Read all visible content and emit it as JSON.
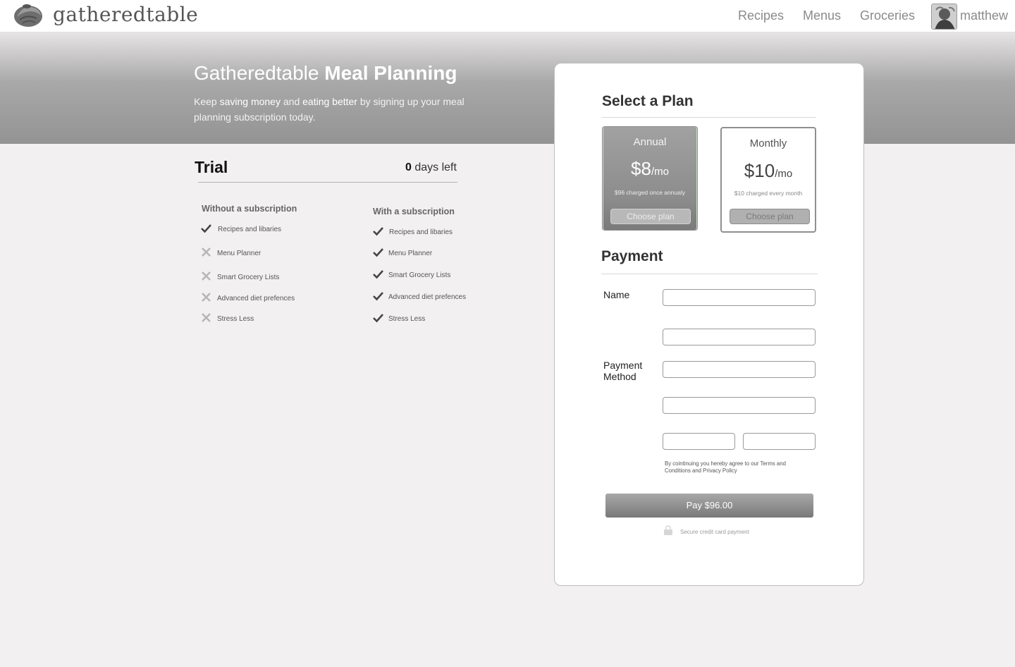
{
  "header": {
    "logo_text": "gatheredtable",
    "nav": {
      "recipes": "Recipes",
      "menus": "Menus",
      "groceries": "Groceries"
    },
    "username": "matthew"
  },
  "hero": {
    "title_light": "Gatheredtable ",
    "title_bold": "Meal Planning",
    "sub_1": "Keep ",
    "sub_em1": "saving money",
    "sub_2": " and ",
    "sub_em2": "eating better",
    "sub_3": " by signing up your meal planning subscription today."
  },
  "trial": {
    "title": "Trial",
    "days_count": "0",
    "days_suffix": " days left",
    "without_head": "Without a subscription",
    "with_head": "With a subscription",
    "features": [
      {
        "label": "Recipes and libaries",
        "without": "check",
        "with": "check"
      },
      {
        "label": "Menu Planner",
        "without": "x",
        "with": "check"
      },
      {
        "label": "Smart Grocery Lists",
        "without": "x",
        "with": "check"
      },
      {
        "label": "Advanced diet prefences",
        "without": "x",
        "with": "check"
      },
      {
        "label": "Stress Less",
        "without": "x",
        "with": "check"
      }
    ]
  },
  "plans": {
    "heading": "Select a Plan",
    "annual": {
      "name": "Annual",
      "price": "$8",
      "per": "/mo",
      "note": "$96 charged once annualy",
      "button": "Choose plan"
    },
    "monthly": {
      "name": "Monthly",
      "price": "$10",
      "per": "/mo",
      "note": "$10 charged every month",
      "button": "Choose plan"
    }
  },
  "payment": {
    "heading": "Payment",
    "name_label": "Name",
    "method_label": "Payment Method",
    "terms": "By cointinuing you hereby agree to our Terms and Conditions and Privacy Policy",
    "pay_button": "Pay $96.00",
    "secure_text": "Secure credit card payment"
  },
  "colors": {
    "accent_gray": "#8d8c8d",
    "background": "#f2f0f1",
    "check": "#444444",
    "x": "#b5b5b5"
  }
}
